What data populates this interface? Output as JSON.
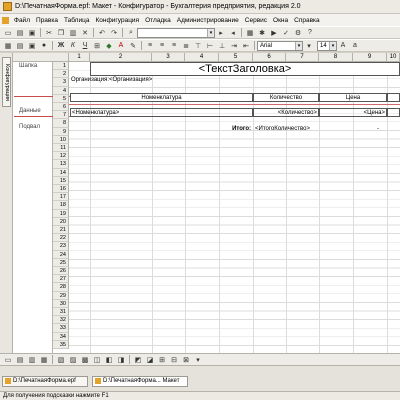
{
  "window": {
    "title": "D:\\ПечатнаяФорма.epf: Макет - Конфигуратор - Бухгалтерия предприятия, редакция 2.0"
  },
  "menu": [
    "Файл",
    "Правка",
    "Таблица",
    "Конфигурация",
    "Отладка",
    "Администрирование",
    "Сервис",
    "Окна",
    "Справка"
  ],
  "toolbar2": {
    "font": "Arial",
    "font_size": "14"
  },
  "side_tab": "Конфигурация",
  "columns": [
    "1",
    "2",
    "3",
    "4",
    "5",
    "6",
    "7",
    "8",
    "9",
    "10"
  ],
  "rows": [
    "1",
    "2",
    "3",
    "4",
    "5",
    "6",
    "7",
    "8",
    "9",
    "10",
    "11",
    "12",
    "13",
    "14",
    "15",
    "16",
    "17",
    "18",
    "19",
    "20",
    "21",
    "22",
    "23",
    "24",
    "25",
    "26",
    "27",
    "28",
    "29",
    "30",
    "31",
    "32",
    "33",
    "34",
    "35"
  ],
  "groups": {
    "header": "Шапка",
    "data": "Данные",
    "footer": "Подвал"
  },
  "cells": {
    "title": "<ТекстЗаголовка>",
    "org_label": "Организация:",
    "org_value": "<Организация>",
    "col_nomenclature": "Номенклатура",
    "col_quantity": "Количество",
    "col_price": "Цена",
    "row_nomenclature": "<Номенклатура>",
    "row_quantity": "<Количество>",
    "row_price": "<Цена>",
    "total_label": "Итого:",
    "total_value": "<ИтогоКоличество>",
    "total_dash": "-"
  },
  "window_tabs": [
    "D:\\ПечатнаяФорма.epf",
    "D:\\ПечатнаяФорма...   Макет"
  ],
  "status": "Для получения подсказки нажмите F1"
}
